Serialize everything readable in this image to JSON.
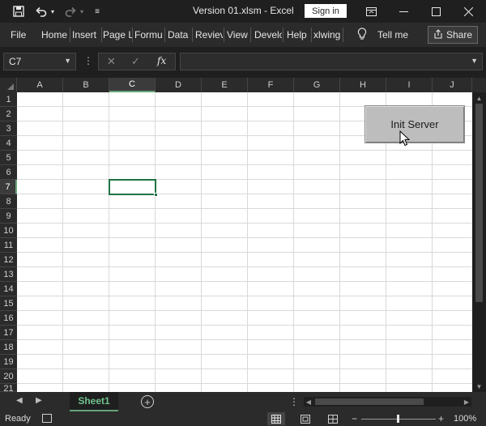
{
  "titlebar": {
    "doc_title": "Version 01.xlsm  -  Excel",
    "signin_label": "Sign in",
    "icons": [
      "save-icon",
      "undo-icon",
      "redo-icon",
      "customize-qat-icon",
      "ribbon-display-icon",
      "minimize-icon",
      "maximize-icon",
      "close-icon"
    ]
  },
  "ribbon": {
    "tabs": [
      "File",
      "Home",
      "Insert",
      "Page L",
      "Formu",
      "Data",
      "Reviev",
      "View",
      "Develo",
      "Help",
      "xlwing"
    ],
    "tell_me": "Tell me",
    "share": "Share"
  },
  "formula_bar": {
    "name_box": "C7",
    "formula_value": ""
  },
  "grid": {
    "columns": [
      "A",
      "B",
      "C",
      "D",
      "E",
      "F",
      "G",
      "H",
      "I",
      "J"
    ],
    "rows": [
      "1",
      "2",
      "3",
      "4",
      "5",
      "6",
      "7",
      "8",
      "9",
      "10",
      "11",
      "12",
      "13",
      "14",
      "15",
      "16",
      "17",
      "18",
      "19",
      "20",
      "21"
    ],
    "selected_column": "C",
    "selected_row": "7",
    "button_label": "Init Server"
  },
  "sheets": {
    "tabs": [
      "Sheet1"
    ],
    "active": "Sheet1"
  },
  "status": {
    "ready": "Ready",
    "zoom": "100%"
  }
}
